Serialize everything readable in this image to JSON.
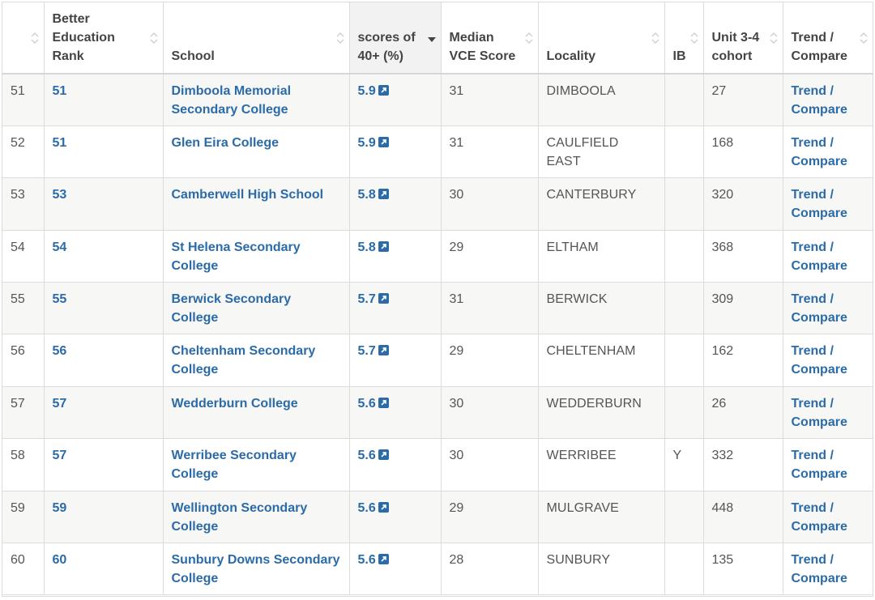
{
  "headers": {
    "row_num": "",
    "rank": "Better Education Rank",
    "school": "School",
    "scores": "scores of 40+ (%)",
    "median": "Median VCE Score",
    "locality": "Locality",
    "ib": "IB",
    "cohort": "Unit 3-4 cohort",
    "trend": "Trend / Compare"
  },
  "rows": [
    {
      "num": "51",
      "rank": "51",
      "school": "Dimboola Memorial Secondary College",
      "score": "5.9",
      "median": "31",
      "locality": "DIMBOOLA",
      "ib": "",
      "cohort": "27",
      "trend": "Trend / Compare"
    },
    {
      "num": "52",
      "rank": "51",
      "school": "Glen Eira College",
      "score": "5.9",
      "median": "31",
      "locality": "CAULFIELD EAST",
      "ib": "",
      "cohort": "168",
      "trend": "Trend / Compare"
    },
    {
      "num": "53",
      "rank": "53",
      "school": "Camberwell High School",
      "score": "5.8",
      "median": "30",
      "locality": "CANTERBURY",
      "ib": "",
      "cohort": "320",
      "trend": "Trend / Compare"
    },
    {
      "num": "54",
      "rank": "54",
      "school": "St Helena Secondary College",
      "score": "5.8",
      "median": "29",
      "locality": "ELTHAM",
      "ib": "",
      "cohort": "368",
      "trend": "Trend / Compare"
    },
    {
      "num": "55",
      "rank": "55",
      "school": "Berwick Secondary College",
      "score": "5.7",
      "median": "31",
      "locality": "BERWICK",
      "ib": "",
      "cohort": "309",
      "trend": "Trend / Compare"
    },
    {
      "num": "56",
      "rank": "56",
      "school": "Cheltenham Secondary College",
      "score": "5.7",
      "median": "29",
      "locality": "CHELTENHAM",
      "ib": "",
      "cohort": "162",
      "trend": "Trend / Compare"
    },
    {
      "num": "57",
      "rank": "57",
      "school": "Wedderburn College",
      "score": "5.6",
      "median": "30",
      "locality": "WEDDERBURN",
      "ib": "",
      "cohort": "26",
      "trend": "Trend / Compare"
    },
    {
      "num": "58",
      "rank": "57",
      "school": "Werribee Secondary College",
      "score": "5.6",
      "median": "30",
      "locality": "WERRIBEE",
      "ib": "Y",
      "cohort": "332",
      "trend": "Trend / Compare"
    },
    {
      "num": "59",
      "rank": "59",
      "school": "Wellington Secondary College",
      "score": "5.6",
      "median": "29",
      "locality": "MULGRAVE",
      "ib": "",
      "cohort": "448",
      "trend": "Trend / Compare"
    },
    {
      "num": "60",
      "rank": "60",
      "school": "Sunbury Downs Secondary College",
      "score": "5.6",
      "median": "28",
      "locality": "SUNBURY",
      "ib": "",
      "cohort": "135",
      "trend": "Trend / Compare"
    }
  ],
  "colors": {
    "link": "#2b6ba8",
    "text": "#555555",
    "header_text": "#444444",
    "border": "#dcdcdc",
    "row_alt": "#f7f7f5",
    "sorted_header": "#f2f2f2"
  },
  "icons": {
    "sort": "sort-up-down-icon",
    "sort_active": "sort-desc-icon",
    "external": "external-link-icon"
  }
}
